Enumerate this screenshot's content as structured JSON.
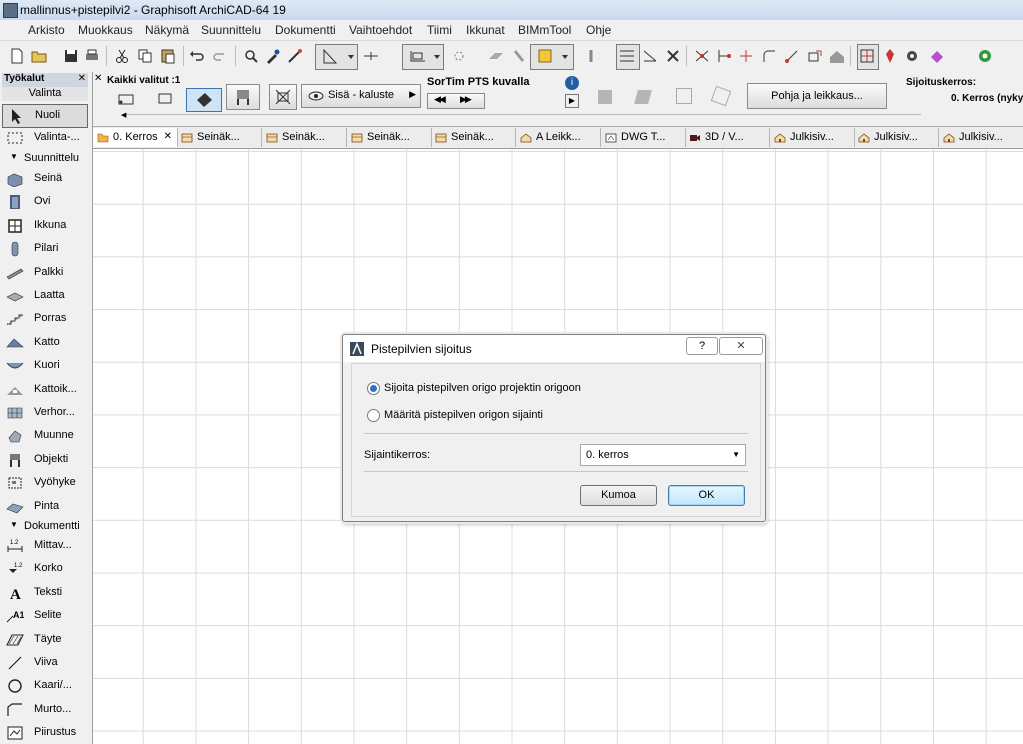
{
  "window": {
    "title": "mallinnus+pistepilvi2 - Graphisoft ArchiCAD-64 19"
  },
  "menu": [
    "Arkisto",
    "Muokkaus",
    "Näkymä",
    "Suunnittelu",
    "Dokumentti",
    "Vaihtoehdot",
    "Tiimi",
    "Ikkunat",
    "BIMmTool",
    "Ohje"
  ],
  "toolbox": {
    "title": "Työkalut",
    "section_select": "Valinta",
    "close_glyph": "✕",
    "select_tools": [
      {
        "label": "Nuoli",
        "icon": "arrow-icon"
      },
      {
        "label": "Valinta-...",
        "icon": "marquee-icon"
      }
    ],
    "section_design": "Suunnittelu",
    "design_tools": [
      {
        "label": "Seinä",
        "icon": "wall-icon"
      },
      {
        "label": "Ovi",
        "icon": "door-icon"
      },
      {
        "label": "Ikkuna",
        "icon": "window-icon"
      },
      {
        "label": "Pilari",
        "icon": "column-icon"
      },
      {
        "label": "Palkki",
        "icon": "beam-icon"
      },
      {
        "label": "Laatta",
        "icon": "slab-icon"
      },
      {
        "label": "Porras",
        "icon": "stair-icon"
      },
      {
        "label": "Katto",
        "icon": "roof-icon"
      },
      {
        "label": "Kuori",
        "icon": "shell-icon"
      },
      {
        "label": "Kattoik...",
        "icon": "skylight-icon"
      },
      {
        "label": "Verhor...",
        "icon": "curtain-wall-icon"
      },
      {
        "label": "Muunne",
        "icon": "morph-icon"
      },
      {
        "label": "Objekti",
        "icon": "object-icon"
      },
      {
        "label": "Vyöhyke",
        "icon": "zone-icon"
      },
      {
        "label": "Pinta",
        "icon": "mesh-icon"
      }
    ],
    "section_document": "Dokumentti",
    "document_tools": [
      {
        "label": "Mittav...",
        "icon": "dimension-icon"
      },
      {
        "label": "Korko",
        "icon": "level-dimension-icon"
      },
      {
        "label": "Teksti",
        "icon": "text-icon"
      },
      {
        "label": "Selite",
        "icon": "label-icon"
      },
      {
        "label": "Täyte",
        "icon": "fill-icon"
      },
      {
        "label": "Viiva",
        "icon": "line-icon"
      },
      {
        "label": "Kaari/...",
        "icon": "arc-icon"
      },
      {
        "label": "Murto...",
        "icon": "polyline-icon"
      },
      {
        "label": "Piirustus",
        "icon": "drawing-icon"
      }
    ]
  },
  "infobox": {
    "selected_label": "Kaikki valitut :1",
    "layer_value": "Sisä - kaluste",
    "object_name": "SorTim PTS  kuvalla",
    "floorplan_button": "Pohja ja leikkaus...",
    "home_story_label": "Sijoituskerros:",
    "home_story_value": "0. Kerros (nyky"
  },
  "tabs": [
    {
      "label": "0. Kerros",
      "icon": "floorplan-tab-icon",
      "active": true
    },
    {
      "label": "Seinäk...",
      "icon": "elevation-tab-icon"
    },
    {
      "label": "Seinäk...",
      "icon": "elevation-tab-icon"
    },
    {
      "label": "Seinäk...",
      "icon": "elevation-tab-icon"
    },
    {
      "label": "Seinäk...",
      "icon": "elevation-tab-icon"
    },
    {
      "label": "A Leikk...",
      "icon": "section-tab-icon"
    },
    {
      "label": "DWG T...",
      "icon": "worksheet-tab-icon"
    },
    {
      "label": "3D / V...",
      "icon": "3d-tab-icon"
    },
    {
      "label": "Julkisiv...",
      "icon": "house-tab-icon"
    },
    {
      "label": "Julkisiv...",
      "icon": "house-tab-icon"
    },
    {
      "label": "Julkisiv...",
      "icon": "house-tab-icon"
    }
  ],
  "tab_close_glyph": "✕",
  "dialog": {
    "title": "Pistepilvien sijoitus",
    "help_glyph": "?",
    "close_glyph": "✕",
    "option1": "Sijoita pistepilven origo projektin origoon",
    "option2": "Määritä pistepilven origon sijainti",
    "selected_option": 1,
    "story_label": "Sijaintikerros:",
    "story_value": "0. kerros",
    "cancel_label": "Kumoa",
    "ok_label": "OK"
  },
  "colors": {
    "accent": "#2b6fd1",
    "grid": "#dcdcdc",
    "default_button": "#3c7fb1"
  }
}
